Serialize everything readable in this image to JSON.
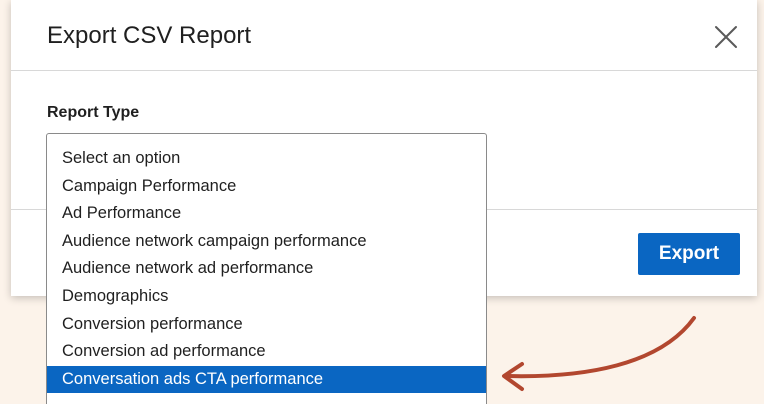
{
  "dialog": {
    "title": "Export CSV Report",
    "close_icon": "close-icon",
    "field_label": "Report Type",
    "export_label": "Export"
  },
  "select": {
    "options": [
      "Select an option",
      "Campaign Performance",
      "Ad Performance",
      "Audience network campaign performance",
      "Audience network ad performance",
      "Demographics",
      "Conversion performance",
      "Conversion ad performance",
      "Conversation ads CTA performance"
    ],
    "selected_index": 8,
    "selected_value": "Conversation ads CTA performance"
  },
  "colors": {
    "accent": "#0a66c2",
    "background": "#fcf3ea",
    "annotation_arrow": "#b2472f"
  }
}
